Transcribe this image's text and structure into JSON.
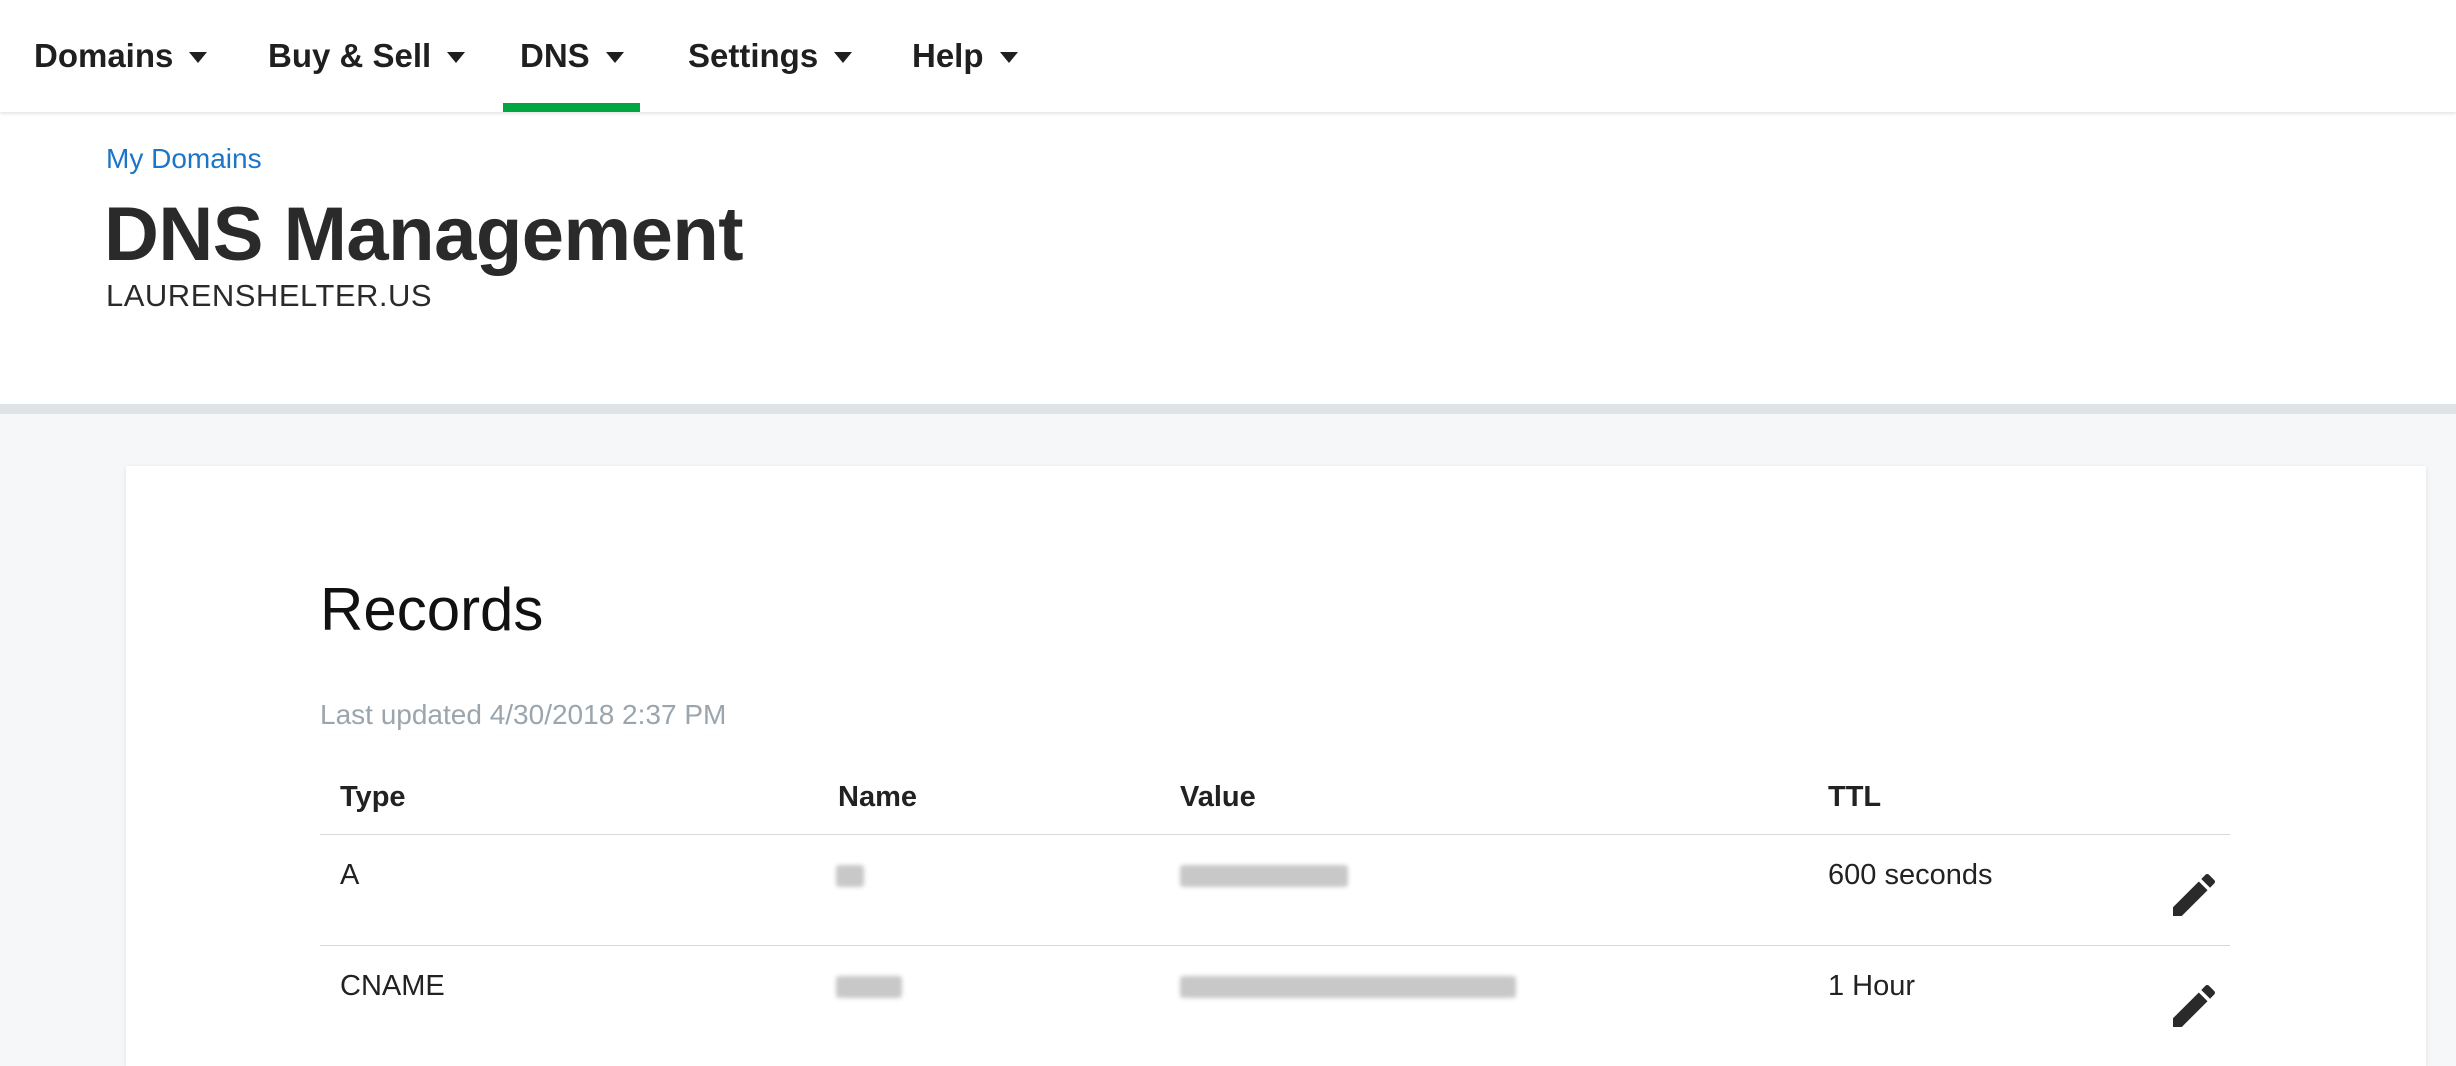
{
  "nav": {
    "items": [
      {
        "label": "Domains"
      },
      {
        "label": "Buy & Sell"
      },
      {
        "label": "DNS"
      },
      {
        "label": "Settings"
      },
      {
        "label": "Help"
      }
    ],
    "active": "DNS",
    "accent": "#00a63f"
  },
  "header": {
    "breadcrumb": "My Domains",
    "title": "DNS Management",
    "domain": "LAURENSHELTER.US"
  },
  "records": {
    "title": "Records",
    "last_updated": "Last updated 4/30/2018 2:37 PM",
    "columns": [
      "Type",
      "Name",
      "Value",
      "TTL"
    ],
    "rows": [
      {
        "type": "A",
        "ttl": "600 seconds",
        "edit_icon": "pencil-icon"
      },
      {
        "type": "CNAME",
        "ttl": "1 Hour",
        "edit_icon": "pencil-icon"
      }
    ]
  },
  "colors": {
    "link": "#1b75c9",
    "muted": "#9aa5ad",
    "page_bg": "#f5f7f8"
  }
}
